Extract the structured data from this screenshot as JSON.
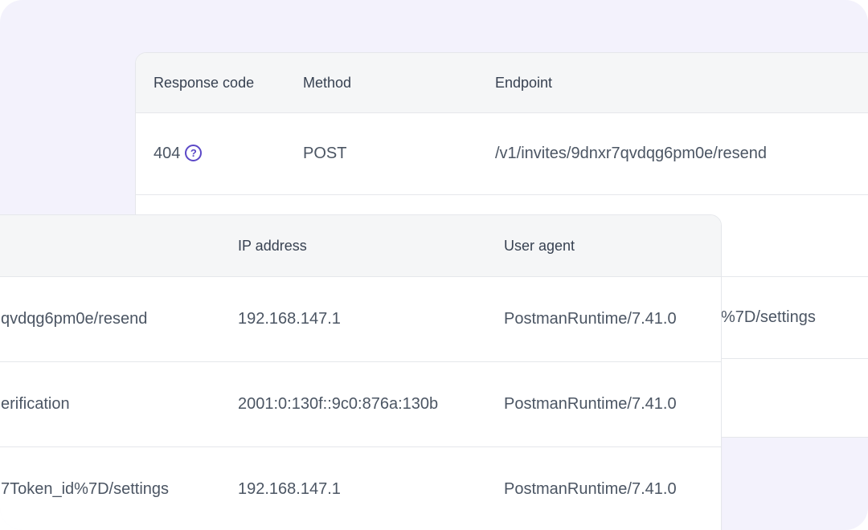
{
  "back_table": {
    "headers": {
      "response_code": "Response code",
      "method": "Method",
      "endpoint": "Endpoint"
    },
    "rows": [
      {
        "response_code": "404",
        "method": "POST",
        "endpoint": "/v1/invites/9dnxr7qvdqg6pm0e/resend",
        "icon": "help-icon"
      },
      {
        "response_code": "",
        "method": "",
        "endpoint": ""
      },
      {
        "response_code": "",
        "method": "",
        "endpoint": "%7D/settings"
      },
      {
        "response_code": "",
        "method": "",
        "endpoint": ""
      }
    ]
  },
  "front_table": {
    "headers": {
      "endpoint": "",
      "ip_address": "IP address",
      "user_agent": "User agent"
    },
    "rows": [
      {
        "endpoint": "qvdqg6pm0e/resend",
        "ip_address": "192.168.147.1",
        "user_agent": "PostmanRuntime/7.41.0"
      },
      {
        "endpoint": "erification",
        "ip_address": "2001:0:130f::9c0:876a:130b",
        "user_agent": "PostmanRuntime/7.41.0"
      },
      {
        "endpoint": "7Token_id%7D/settings",
        "ip_address": "192.168.147.1",
        "user_agent": "PostmanRuntime/7.41.0"
      }
    ]
  },
  "colors": {
    "background": "#f3f2fc",
    "header_bg": "#f5f6f7",
    "border": "#e5e7eb",
    "accent": "#5b48c7",
    "text": "#4b5563"
  }
}
